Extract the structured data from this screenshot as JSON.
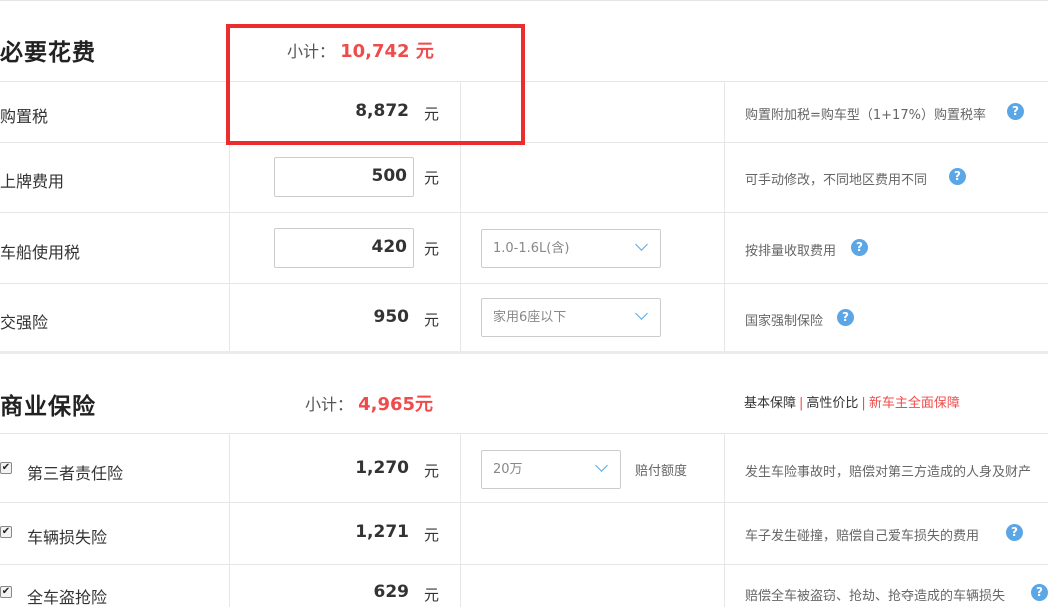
{
  "required": {
    "title": "必要花费",
    "subtotal_label": "小计：",
    "subtotal_value": "10,742 元",
    "rows": [
      {
        "label": "购置税",
        "value": "8,872",
        "unit": "元",
        "note": "购置附加税=购车型（1+17%）购置税率"
      },
      {
        "label": "上牌费用",
        "value": "500",
        "unit": "元",
        "note": "可手动修改，不同地区费用不同"
      },
      {
        "label": "车船使用税",
        "value": "420",
        "unit": "元",
        "select": "1.0-1.6L(含)",
        "note": "按排量收取费用"
      },
      {
        "label": "交强险",
        "value": "950",
        "unit": "元",
        "select": "家用6座以下",
        "note": "国家强制保险"
      }
    ]
  },
  "commercial": {
    "title": "商业保险",
    "subtotal_label": "小计：",
    "subtotal_value": "4,965元",
    "links": [
      "基本保障",
      "高性价比",
      "新车主全面保障"
    ],
    "rows": [
      {
        "label": "第三者责任险",
        "value": "1,270",
        "unit": "元",
        "select": "20万",
        "select_suffix": "赔付额度",
        "note": "发生车险事故时，赔偿对第三方造成的人身及财产"
      },
      {
        "label": "车辆损失险",
        "value": "1,271",
        "unit": "元",
        "note": "车子发生碰撞，赔偿自己爱车损失的费用"
      },
      {
        "label": "全车盗抢险",
        "value": "629",
        "unit": "元",
        "note": "赔偿全车被盗窃、抢劫、抢夺造成的车辆损失"
      }
    ]
  },
  "help_glyph": "?",
  "check_glyph": "✔",
  "colors": {
    "accent_red": "#f04b4b",
    "highlight_border": "#ec2d2d",
    "help_blue": "#5aa6e6"
  }
}
